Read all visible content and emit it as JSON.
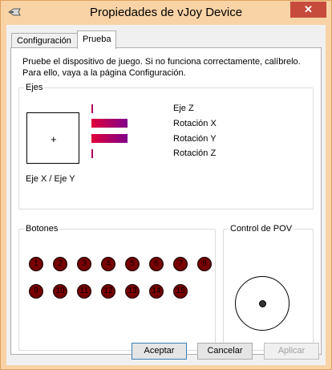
{
  "window": {
    "title": "Propiedades de vJoy Device",
    "close_glyph": "✕",
    "icon": "joystick-icon"
  },
  "tabs": [
    {
      "label": "Configuración",
      "active": false
    },
    {
      "label": "Prueba",
      "active": true
    }
  ],
  "description": "Pruebe el dispositivo de juego. Si no funciona correctamente, calíbrelo. Para ello, vaya a la página Configuración.",
  "axes": {
    "group_label": "Ejes",
    "xy_label": "Eje X / Eje Y",
    "crosshair": "+",
    "items": [
      {
        "label": "Eje Z",
        "level": 0.02
      },
      {
        "label": "Rotación X",
        "level": 0.45
      },
      {
        "label": "Rotación Y",
        "level": 0.45
      },
      {
        "label": "Rotación Z",
        "level": 0.02
      }
    ]
  },
  "buttons": {
    "group_label": "Botones",
    "items": [
      "1",
      "2",
      "3",
      "4",
      "5",
      "6",
      "7",
      "8",
      "9",
      "10",
      "11",
      "12",
      "13",
      "14",
      "15"
    ]
  },
  "pov": {
    "group_label": "Control de POV"
  },
  "dialog_buttons": {
    "accept": "Aceptar",
    "cancel": "Cancelar",
    "apply": "Aplicar"
  },
  "colors": {
    "titlebar": "#f9d3a6",
    "close_button": "#c74b3c",
    "axis_bar_start": "#e0003a",
    "axis_bar_end": "#80008a",
    "joy_button": "#6b0000"
  }
}
